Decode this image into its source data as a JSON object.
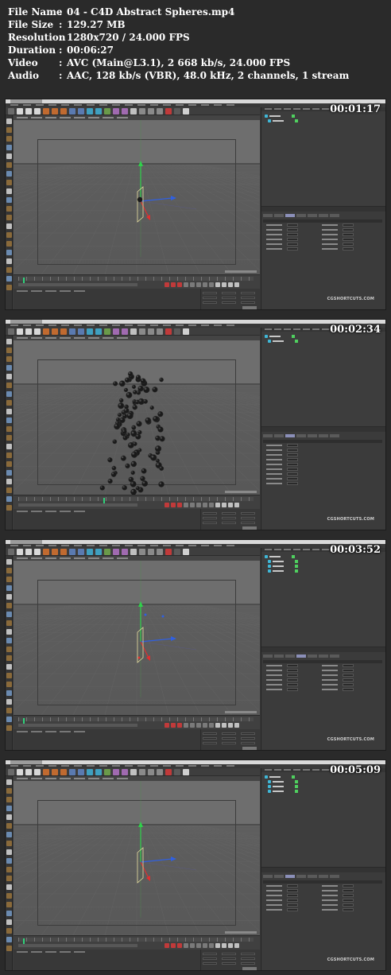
{
  "header": {
    "rows": [
      {
        "key": "File Name",
        "value": "04 - C4D Abstract Spheres.mp4"
      },
      {
        "key": "File Size",
        "value": "129.27 MB"
      },
      {
        "key": "Resolution",
        "value": "1280x720 / 24.000 FPS"
      },
      {
        "key": "Duration",
        "value": "00:06:27"
      },
      {
        "key": "Video",
        "value": "AVC (Main@L3.1), 2 668 kb/s, 24.000 FPS"
      },
      {
        "key": "Audio",
        "value": "AAC, 128 kb/s (VBR), 48.0 kHz, 2 channels, 1 stream"
      }
    ],
    "separator": ":"
  },
  "frames": [
    {
      "timecode": "00:01:17",
      "watermark": "CGSHORTCUTS.COM",
      "scene": "rig",
      "playhead": 0.02
    },
    {
      "timecode": "00:02:34",
      "watermark": "CGSHORTCUTS.COM",
      "scene": "spheres",
      "playhead": 0.36
    },
    {
      "timecode": "00:03:52",
      "watermark": "CGSHORTCUTS.COM",
      "scene": "rig-blue",
      "playhead": 0.02
    },
    {
      "timecode": "00:05:09",
      "watermark": "CGSHORTCUTS.COM",
      "scene": "rig",
      "playhead": 0.02
    }
  ],
  "colors": {
    "accent_green": "#2fd27a",
    "axis_x": "#e03030",
    "axis_y": "#2fd24a",
    "axis_z": "#3060e0",
    "object_dot": "#3fb8d8"
  }
}
